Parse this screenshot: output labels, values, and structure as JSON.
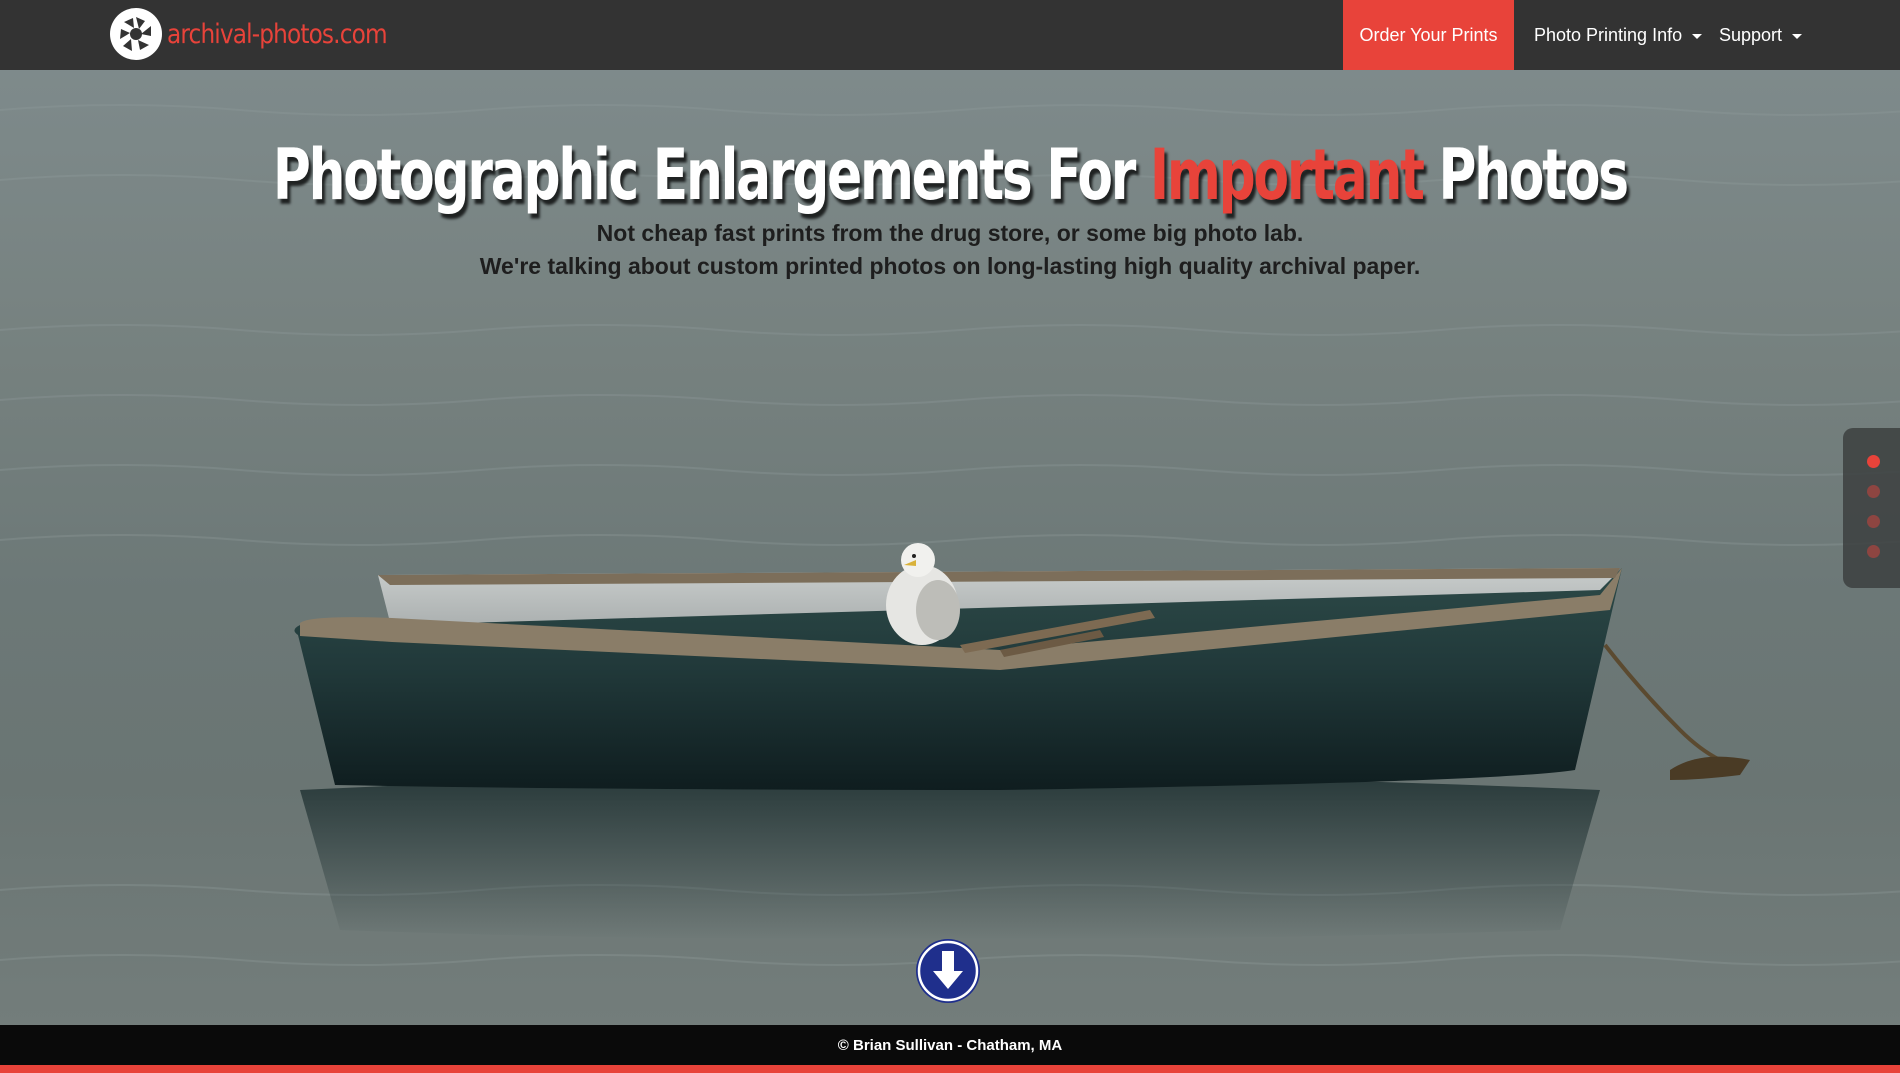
{
  "brand": {
    "name": "archival-photos.com",
    "logo_icon": "camera-aperture-icon"
  },
  "nav": {
    "order_label": "Order Your Prints",
    "info_label": "Photo Printing Info",
    "support_label": "Support"
  },
  "hero": {
    "headline_before": "Photographic Enlargements For ",
    "headline_accent": "Important",
    "headline_after": " Photos",
    "subline_1": "Not cheap fast prints from the drug store, or some big photo lab.",
    "subline_2": "We're talking about custom printed photos on long-lasting high quality archival paper.",
    "scroll_icon": "arrow-down-circle-icon"
  },
  "side_nav": {
    "dots": 4,
    "active_index": 0
  },
  "footer": {
    "copyright": "© Brian Sullivan - Chatham, MA"
  },
  "colors": {
    "accent": "#e8433a",
    "navbar": "#333333",
    "footer": "#0a0a0a",
    "scroll_button": "#1f2f8c"
  }
}
